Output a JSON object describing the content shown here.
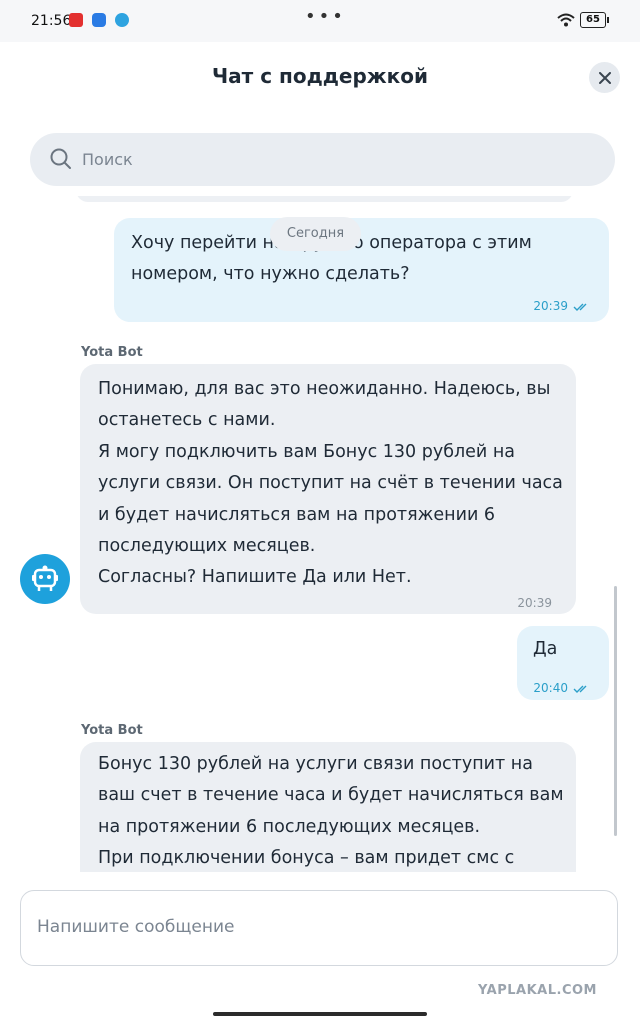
{
  "status_bar": {
    "time": "21:56",
    "battery": "65"
  },
  "header": {
    "title": "Чат с поддержкой"
  },
  "search": {
    "placeholder": "Поиск"
  },
  "chat": {
    "date_separator": "Сегодня",
    "messages": [
      {
        "direction": "out",
        "text": "Хочу перейти на другого оператора с этим\nномером, что нужно сделать?",
        "time": "20:39",
        "status": "read"
      },
      {
        "direction": "in",
        "sender": "Yota Bot",
        "text": "Понимаю, для вас это неожиданно. Надеюсь, вы\nостанетесь с нами.\nЯ могу подключить вам Бонус 130 рублей на\nуслуги связи. Он поступит на счёт в течении часа\nи будет начисляться вам на протяжении 6\nпоследующих месяцев.\nСогласны? Напишите Да или Нет.",
        "time": "20:39"
      },
      {
        "direction": "out",
        "text": "Да",
        "time": "20:40",
        "status": "read"
      },
      {
        "direction": "in",
        "sender": "Yota Bot",
        "text": "Бонус 130 рублей на услуги связи поступит на\nваш счет в течение часа и будет начисляться вам\nна протяжении 6 последующих месяцев.\nПри подключении бонуса – вам придет смс с",
        "time": ""
      }
    ]
  },
  "composer": {
    "placeholder": "Напишите сообщение"
  },
  "watermark": "YAPLAKAL.COM",
  "colors": {
    "accent": "#1ea1dc",
    "outgoing_bubble": "#e4f3fb",
    "incoming_bubble": "#eceff3"
  }
}
